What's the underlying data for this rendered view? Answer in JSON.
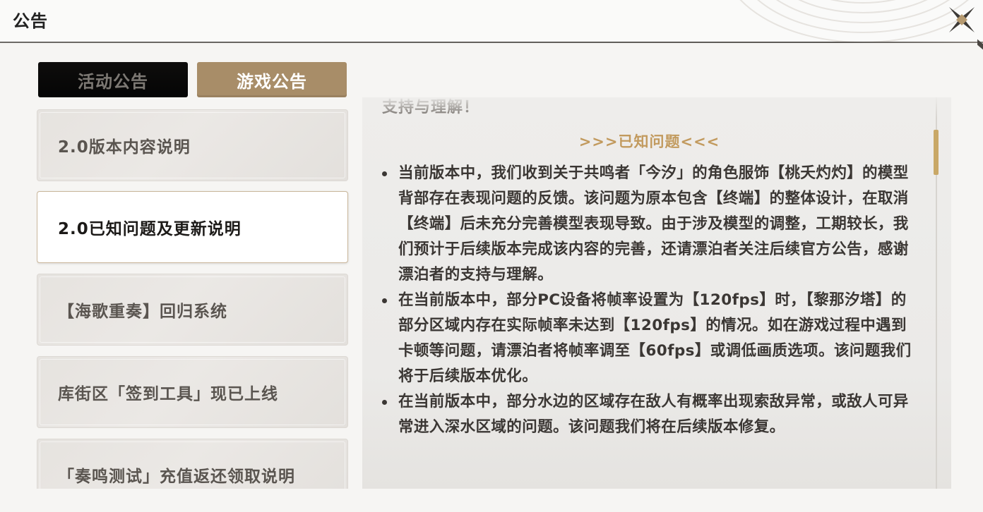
{
  "header": {
    "title": "公告"
  },
  "tabs": [
    {
      "label": "活动公告",
      "active": false
    },
    {
      "label": "游戏公告",
      "active": true
    }
  ],
  "list": {
    "items": [
      {
        "label": "2.0版本内容说明",
        "selected": false
      },
      {
        "label": "2.0已知问题及更新说明",
        "selected": true
      },
      {
        "label": "【海歌重奏】回归系统",
        "selected": false
      },
      {
        "label": "库街区「签到工具」现已上线",
        "selected": false
      },
      {
        "label": "「奏鸣测试」充值返还领取说明",
        "selected": false
      }
    ]
  },
  "content": {
    "cut_line": "支持与理解！",
    "section_heading": ">>>已知问题<<<",
    "bullets": [
      "当前版本中，我们收到关于共鸣者「今汐」的角色服饰【桃夭灼灼】的模型背部存在表现问题的反馈。该问题为原本包含【终端】的整体设计，在取消【终端】后未充分完善模型表现导致。由于涉及模型的调整，工期较长，我们预计于后续版本完成该内容的完善，还请漂泊者关注后续官方公告，感谢漂泊者的支持与理解。",
      "在当前版本中，部分PC设备将帧率设置为【120fps】时，【黎那汐塔】的部分区域内存在实际帧率未达到【120fps】的情况。如在游戏过程中遇到卡顿等问题，请漂泊者将帧率调至【60fps】或调低画质选项。该问题我们将于后续版本优化。",
      "在当前版本中，部分水边的区域存在敌人有概率出现索敌异常，或敌人可异常进入深水区域的问题。该问题我们将在后续版本修复。"
    ]
  },
  "icons": {
    "close": "close-x-icon",
    "decor": "ring-pattern-icon"
  },
  "colors": {
    "accent_gold": "#c29a5e",
    "active_tab": "#a88d68",
    "scroll_thumb": "#c9a867"
  }
}
